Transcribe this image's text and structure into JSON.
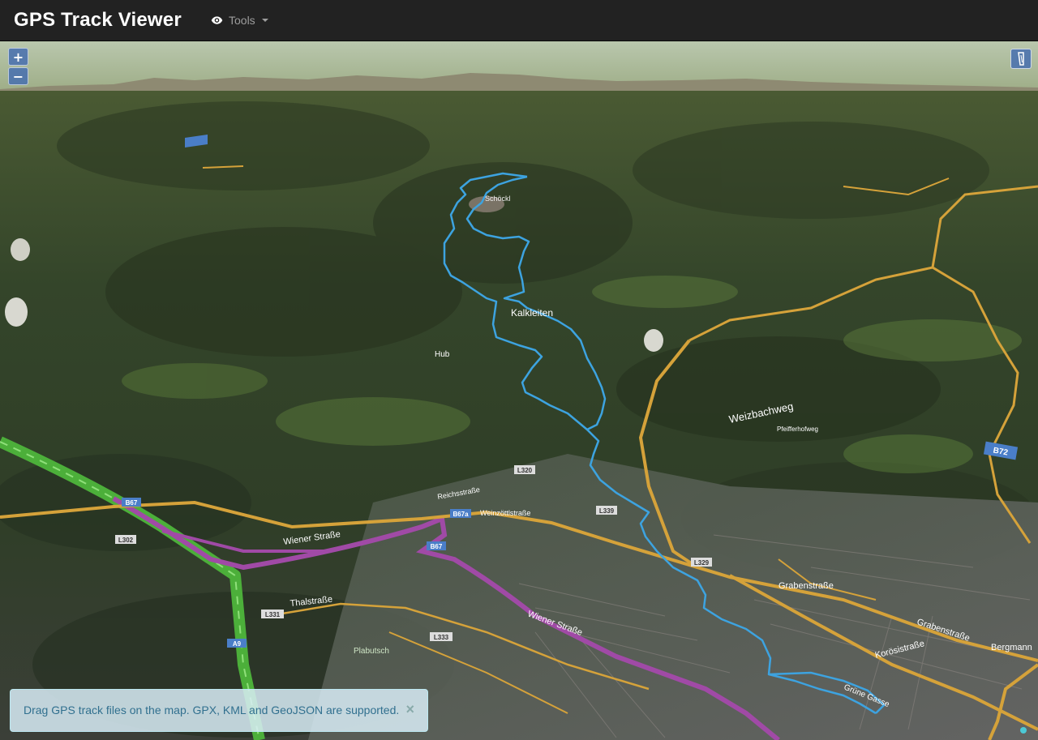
{
  "app": {
    "title": "GPS Track Viewer",
    "tools_label": "Tools",
    "tools_icon": "eye-icon"
  },
  "map": {
    "zoom_in_label": "+",
    "zoom_out_label": "−",
    "tilt_icon": "rotate-icon",
    "track_color": "#3da3e0",
    "labels": {
      "schoeckl": "Schöckl",
      "kalkleiten": "Kalkleiten",
      "weizbachweg": "Weizbachweg",
      "wiener_strasse": "Wiener Straße",
      "wiener_strasse_2": "Wiener Straße",
      "grabenstrasse": "Grabenstraße",
      "grabenstrasse_2": "Grabenstraße",
      "thalstrasse": "Thalstraße",
      "korosistrasse": "Korösistraße",
      "gruene_gasse": "Grüne Gasse",
      "weinzoettlstrasse": "Weinzöttlstraße",
      "reichsstrasse": "Reichsstraße",
      "hub": "Hub",
      "pfeifferhofweg": "Pfeifferhofweg",
      "bergmann": "Bergmann",
      "plabutsch": "Plabutsch",
      "roads": [
        "B67",
        "B67a",
        "B67",
        "B72",
        "A9",
        "L331",
        "L333",
        "L339",
        "L320",
        "L329",
        "L302"
      ]
    }
  },
  "notice": {
    "text": "Drag GPS track files on the map. GPX, KML and GeoJSON are supported.",
    "close_label": "×"
  }
}
